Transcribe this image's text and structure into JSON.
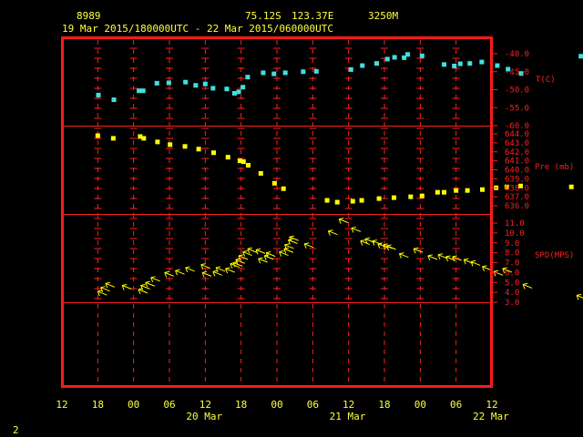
{
  "header": {
    "station_id": "8989",
    "lat": "75.12S",
    "lon": "123.37E",
    "elev": "3250M",
    "range": "19 Mar 2015/180000UTC - 22 Mar 2015/060000UTC"
  },
  "footer": {
    "page_number": "2"
  },
  "chart_data": {
    "type": "scatter",
    "x_axis": {
      "unit": "hours since 19 Mar 2015 12:00 UTC",
      "range": [
        0,
        72
      ],
      "tick_hours": [
        0,
        6,
        12,
        18,
        24,
        30,
        36,
        42,
        48,
        54,
        60,
        66,
        72
      ],
      "tick_labels": [
        "12",
        "18",
        "00",
        "06",
        "12",
        "18",
        "00",
        "06",
        "12",
        "18",
        "00",
        "06",
        "12"
      ],
      "day_labels": [
        {
          "label": "20 Mar",
          "hour": 24
        },
        {
          "label": "21 Mar",
          "hour": 48
        },
        {
          "label": "22 Mar",
          "hour": 72
        }
      ],
      "grid": true
    },
    "panels": [
      {
        "name": "temperature",
        "label": "T(C)",
        "color": "#40e0e0",
        "marker": "square",
        "ylim": [
          -60,
          -40
        ],
        "ticks": [
          "-40.0",
          "-45.0",
          "-50.0",
          "-55.0",
          "-60.0"
        ],
        "tick_values": [
          -40,
          -45,
          -50,
          -55,
          -60
        ],
        "points": [
          [
            6.1,
            -51.5
          ],
          [
            8.7,
            -52.8
          ],
          [
            12.9,
            -50.3
          ],
          [
            13.6,
            -50.3
          ],
          [
            15.9,
            -48.2
          ],
          [
            17.9,
            -48.1
          ],
          [
            20.7,
            -47.9
          ],
          [
            22.4,
            -48.8
          ],
          [
            24,
            -48.4
          ],
          [
            25.3,
            -49.6
          ],
          [
            27.6,
            -49.8
          ],
          [
            28.9,
            -51
          ],
          [
            29.6,
            -50.6
          ],
          [
            30.3,
            -49.3
          ],
          [
            31.1,
            -46.5
          ],
          [
            33.7,
            -45.3
          ],
          [
            35.5,
            -45.6
          ],
          [
            37.4,
            -45.3
          ],
          [
            40.4,
            -45
          ],
          [
            42.6,
            -44.9
          ],
          [
            48.4,
            -44.4
          ],
          [
            50.3,
            -43.3
          ],
          [
            52.7,
            -42.7
          ],
          [
            54.5,
            -41.5
          ],
          [
            55.7,
            -41
          ],
          [
            57.3,
            -41.1
          ],
          [
            57.9,
            -40.2
          ],
          [
            60.3,
            -40.6
          ],
          [
            64,
            -43
          ],
          [
            65.7,
            -43.4
          ],
          [
            66.7,
            -42.8
          ],
          [
            68.3,
            -42.7
          ],
          [
            70.3,
            -42.3
          ],
          [
            72.9,
            -43.3
          ],
          [
            74.7,
            -44.3
          ],
          [
            76.9,
            -45.5
          ],
          [
            86.9,
            -40.7
          ]
        ]
      },
      {
        "name": "pressure",
        "label": "Pre (mb)",
        "color": "#ffff00",
        "marker": "square",
        "ylim": [
          636,
          644.5
        ],
        "ticks": [
          "644.0",
          "643.0",
          "642.0",
          "641.0",
          "640.0",
          "639.0",
          "638.0",
          "637.0",
          "636.0"
        ],
        "tick_values": [
          644,
          643,
          642,
          641,
          640,
          639,
          638,
          637,
          636
        ],
        "points": [
          [
            6,
            643.8
          ],
          [
            8.6,
            643.5
          ],
          [
            13.1,
            643.7
          ],
          [
            13.7,
            643.5
          ],
          [
            16,
            643.1
          ],
          [
            18.1,
            642.8
          ],
          [
            20.6,
            642.6
          ],
          [
            22.9,
            642.3
          ],
          [
            25.4,
            641.9
          ],
          [
            27.8,
            641.4
          ],
          [
            29.8,
            641
          ],
          [
            30.4,
            640.9
          ],
          [
            31.2,
            640.5
          ],
          [
            33.3,
            639.6
          ],
          [
            35.6,
            638.5
          ],
          [
            37.1,
            637.9
          ],
          [
            44.4,
            636.6
          ],
          [
            46.1,
            636.4
          ],
          [
            48.7,
            636.5
          ],
          [
            50.2,
            636.6
          ],
          [
            53.1,
            636.8
          ],
          [
            55.6,
            636.9
          ],
          [
            58.4,
            637
          ],
          [
            60.3,
            637.1
          ],
          [
            62.9,
            637.5
          ],
          [
            64,
            637.5
          ],
          [
            66,
            637.7
          ],
          [
            67.9,
            637.7
          ],
          [
            70.4,
            637.8
          ],
          [
            72.7,
            638
          ],
          [
            74.5,
            638.1
          ],
          [
            76.8,
            638.2
          ],
          [
            85.3,
            638.1
          ]
        ]
      },
      {
        "name": "wind",
        "label": "SPD(MPS)",
        "color": "#ffff00",
        "marker": "arrow",
        "ylim": [
          3,
          11.5
        ],
        "ticks": [
          "11.0",
          "10.0",
          "9.0",
          "8.0",
          "7.0",
          "6.0",
          "5.0",
          "4.0",
          "3.0"
        ],
        "tick_values": [
          11,
          10,
          9,
          8,
          7,
          6,
          5,
          4,
          3
        ],
        "points": [
          [
            6,
            4.1
          ],
          [
            6.5,
            4.5
          ],
          [
            7.3,
            4.9
          ],
          [
            10.1,
            4.7
          ],
          [
            12.8,
            4.3
          ],
          [
            13.2,
            4.7
          ],
          [
            14,
            5
          ],
          [
            14.9,
            5.5
          ],
          [
            17.2,
            6
          ],
          [
            19,
            6.2
          ],
          [
            20.7,
            6.5
          ],
          [
            23.3,
            6.8
          ],
          [
            23.5,
            6
          ],
          [
            25.3,
            6.1
          ],
          [
            25.8,
            6.5
          ],
          [
            27.4,
            6.4
          ],
          [
            28.2,
            6.9
          ],
          [
            28.7,
            7
          ],
          [
            29.1,
            7.3
          ],
          [
            29.6,
            7.7
          ],
          [
            30.3,
            8.1
          ],
          [
            31.1,
            8.4
          ],
          [
            32.5,
            8.3
          ],
          [
            32.9,
            7.4
          ],
          [
            33.9,
            7.7
          ],
          [
            34.2,
            8
          ],
          [
            36.4,
            8.1
          ],
          [
            37.2,
            8.4
          ],
          [
            37.3,
            8.8
          ],
          [
            37.9,
            9.3
          ],
          [
            38.1,
            9.6
          ],
          [
            40.6,
            8.9
          ],
          [
            44.6,
            10.2
          ],
          [
            46.4,
            11.4
          ],
          [
            48.5,
            10.5
          ],
          [
            50,
            9.2
          ],
          [
            50.8,
            9.4
          ],
          [
            52,
            9.2
          ],
          [
            52.9,
            8.9
          ],
          [
            53.8,
            8.8
          ],
          [
            54.4,
            8.7
          ],
          [
            56.5,
            7.9
          ],
          [
            58.9,
            8.4
          ],
          [
            61.3,
            7.7
          ],
          [
            63,
            7.8
          ],
          [
            64.3,
            7.6
          ],
          [
            65.4,
            7.6
          ],
          [
            67.3,
            7.3
          ],
          [
            68.5,
            7.1
          ],
          [
            70.4,
            6.6
          ],
          [
            72.3,
            6.1
          ],
          [
            73.8,
            6.4
          ],
          [
            77.2,
            4.8
          ],
          [
            86.2,
            3.7
          ]
        ]
      }
    ]
  }
}
